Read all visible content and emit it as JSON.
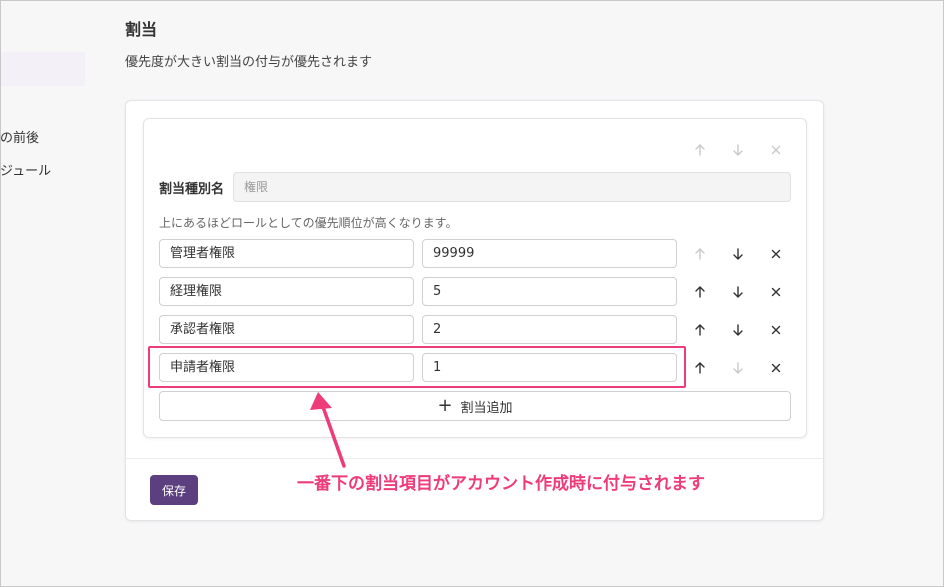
{
  "sidebar": {
    "items": [
      {
        "label": "の前後"
      },
      {
        "label": "ジュール"
      }
    ]
  },
  "page": {
    "title": "割当",
    "description": "優先度が大きい割当の付与が優先されます"
  },
  "allocation": {
    "type_label": "割当種別名",
    "type_placeholder": "権限",
    "hint": "上にあるほどロールとしての優先順位が高くなります。",
    "rows": [
      {
        "name": "管理者権限",
        "value": "99999"
      },
      {
        "name": "経理権限",
        "value": "5"
      },
      {
        "name": "承認者権限",
        "value": "2"
      },
      {
        "name": "申請者権限",
        "value": "1"
      }
    ],
    "add_label": "割当追加",
    "add_icon": "plus-icon"
  },
  "icons": {
    "up": "↑",
    "down": "↓",
    "remove": "×"
  },
  "save_label": "保存",
  "annotation": {
    "text": "一番下の割当項目がアカウント作成時に付与されます",
    "color": "#ee3b7a"
  },
  "colors": {
    "primary": "#5b3f7e",
    "annotation": "#ee3b7a"
  }
}
